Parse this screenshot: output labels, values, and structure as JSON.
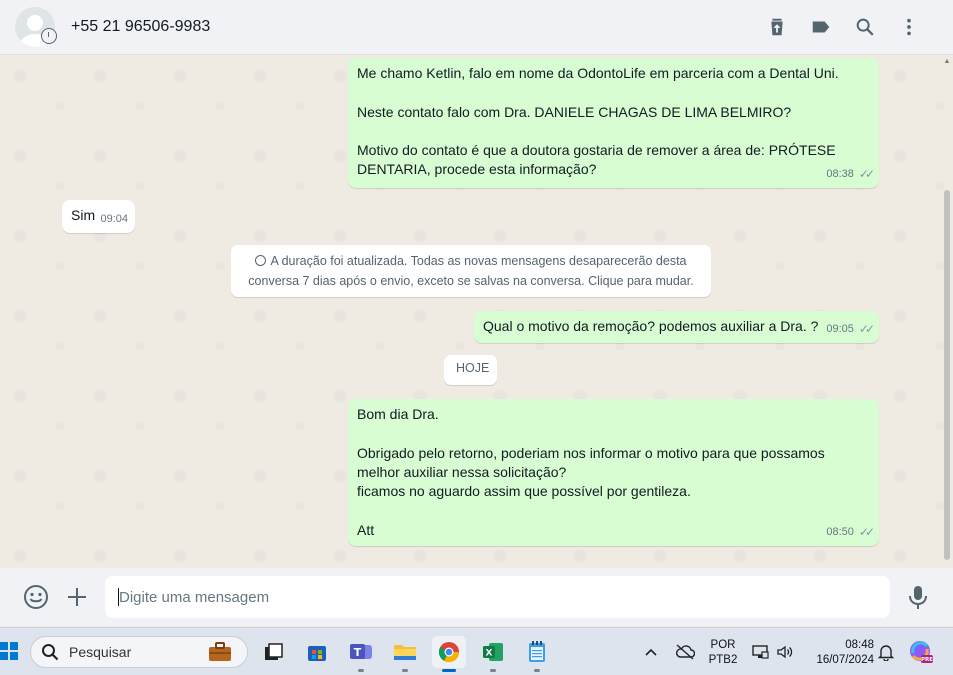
{
  "header": {
    "contact_name": "+55 21 96506-9983",
    "icons": [
      "upload-icon",
      "label-icon",
      "search-icon",
      "menu-icon"
    ]
  },
  "messages": [
    {
      "direction": "out",
      "lines": [
        "Me chamo Ketlin, falo em nome da OdontoLife em parceria com a Dental Uni.",
        "",
        "Neste contato falo com Dra. DANIELE CHAGAS DE LIMA BELMIRO?",
        "",
        "Motivo do contato é que a doutora gostaria de remover a área de: PRÓTESE",
        "DENTARIA, procede esta informação?"
      ],
      "time": "08:38"
    },
    {
      "direction": "in",
      "lines": [
        "Sim"
      ],
      "time": "09:04"
    },
    {
      "direction": "system",
      "lines": [
        "A duração foi atualizada. Todas as novas mensagens desaparecerão desta",
        "conversa 7 dias após o envio, exceto se salvas na conversa. Clique para mudar."
      ]
    },
    {
      "direction": "out",
      "lines": [
        "Qual o motivo da remoção? podemos auxiliar a Dra. ?"
      ],
      "time": "09:05"
    },
    {
      "direction": "date",
      "label": "HOJE"
    },
    {
      "direction": "out",
      "lines": [
        "Bom dia Dra.",
        "",
        "Obrigado pelo retorno, poderiam nos informar o motivo para que possamos",
        "melhor auxiliar nessa solicitação?",
        "ficamos no aguardo assim que possível por gentileza.",
        "",
        "Att"
      ],
      "time": "08:50"
    }
  ],
  "composer": {
    "placeholder": "Digite uma mensagem",
    "icons": [
      "emoji-icon",
      "plus-icon",
      "mic-icon"
    ]
  },
  "taskbar": {
    "search_label": "Pesquisar",
    "apps": [
      "briefcase-icon",
      "task-view-icon",
      "store-icon",
      "teams-icon",
      "file-explorer-icon",
      "chrome-icon",
      "excel-icon",
      "notepad-icon"
    ],
    "language_line1": "POR",
    "language_line2": "PTB2",
    "time": "08:48",
    "date": "16/07/2024",
    "colors": {
      "windows_blue": "#0078d4",
      "bubble_out": "#d9fdd3"
    }
  }
}
